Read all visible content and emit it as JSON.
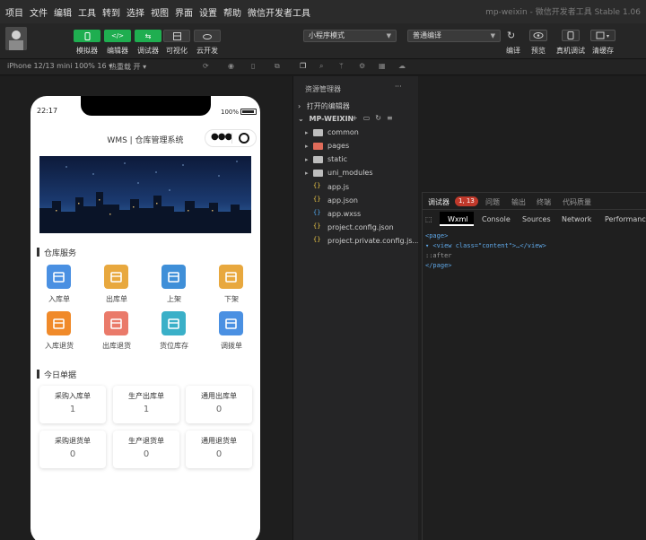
{
  "menubar": {
    "items": [
      "项目",
      "文件",
      "编辑",
      "工具",
      "转到",
      "选择",
      "视图",
      "界面",
      "设置",
      "帮助",
      "微信开发者工具"
    ],
    "window_title": "mp-weixin - 微信开发者工具 Stable 1.06"
  },
  "toolbar": {
    "simulator_label": "模拟器",
    "editor_label": "编辑器",
    "debugger_label": "调试器",
    "visual_label": "可视化",
    "cloud_label": "云开发",
    "mode_select": "小程序模式",
    "compile_select": "普通编译",
    "compile_label": "编译",
    "preview_label": "预览",
    "real_debug_label": "真机调试",
    "clear_cache_label": "清缓存"
  },
  "subbar": {
    "device": "iPhone 12/13 mini 100% 16 ▾",
    "hot_reload": "热重载 开 ▾"
  },
  "phone": {
    "time": "22:17",
    "battery": "100%",
    "nav_title": "WMS | 仓库管理系统",
    "warehouse_section": "仓库服务",
    "services": [
      {
        "label": "入库单",
        "color": "#4a90e2"
      },
      {
        "label": "出库单",
        "color": "#e8a83e"
      },
      {
        "label": "上架",
        "color": "#3f8fd8"
      },
      {
        "label": "下架",
        "color": "#e8a83e"
      },
      {
        "label": "入库退货",
        "color": "#f08a2a"
      },
      {
        "label": "出库退货",
        "color": "#ea7a6a"
      },
      {
        "label": "货位库存",
        "color": "#3ab0c8"
      },
      {
        "label": "调拨单",
        "color": "#4a90e2"
      }
    ],
    "today_section": "今日单据",
    "cards": [
      {
        "title": "采购入库单",
        "value": "1"
      },
      {
        "title": "生产出库单",
        "value": "1"
      },
      {
        "title": "通用出库单",
        "value": "0"
      },
      {
        "title": "采购退货单",
        "value": "0"
      },
      {
        "title": "生产退货单",
        "value": "0"
      },
      {
        "title": "通用退货单",
        "value": "0"
      }
    ]
  },
  "explorer": {
    "title": "资源管理器",
    "open_editors": "打开的编辑器",
    "project": "MP-WEIXIN",
    "entries": [
      {
        "name": "common",
        "kind": "folder",
        "color": "#bdbdbd"
      },
      {
        "name": "pages",
        "kind": "folder",
        "color": "#e06c5a"
      },
      {
        "name": "static",
        "kind": "folder",
        "color": "#bdbdbd"
      },
      {
        "name": "uni_modules",
        "kind": "folder",
        "color": "#bdbdbd"
      },
      {
        "name": "app.js",
        "kind": "file",
        "color": "#e8c547"
      },
      {
        "name": "app.json",
        "kind": "file",
        "color": "#e8c547"
      },
      {
        "name": "app.wxss",
        "kind": "file",
        "color": "#4fa3e8"
      },
      {
        "name": "project.config.json",
        "kind": "file",
        "color": "#e8c547"
      },
      {
        "name": "project.private.config.js...",
        "kind": "file",
        "color": "#e8c547"
      }
    ]
  },
  "debugger": {
    "tabs": [
      "调试器",
      "问题",
      "输出",
      "终端",
      "代码质量"
    ],
    "error_badge": "1, 13",
    "subtabs": [
      "Wxml",
      "Console",
      "Sources",
      "Network",
      "Performance"
    ],
    "code_lines": [
      "<page>",
      "▾ <view class=\"content\">…</view>",
      "  ::after",
      "</page>"
    ]
  }
}
